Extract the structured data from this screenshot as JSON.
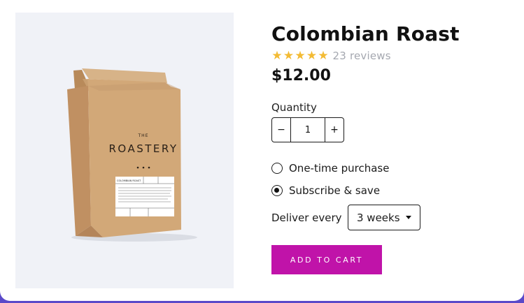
{
  "product": {
    "title": "Colombian Roast",
    "rating": 5,
    "reviews": "23 reviews",
    "price": "$12.00",
    "image": {
      "brand_small": "THE",
      "brand": "ROASTERY",
      "label_name": "COLOMBIAN ROAST"
    }
  },
  "quantity": {
    "label": "Quantity",
    "value": "1",
    "minus": "−",
    "plus": "+"
  },
  "purchase_options": [
    {
      "label": "One-time purchase",
      "checked": false
    },
    {
      "label": "Subscribe & save",
      "checked": true
    }
  ],
  "delivery": {
    "label": "Deliver every",
    "selected": "3 weeks"
  },
  "add_to_cart": "ADD TO CART",
  "colors": {
    "accent": "#c013a9",
    "star": "#f3bb34",
    "frame": "#5a49c9"
  }
}
